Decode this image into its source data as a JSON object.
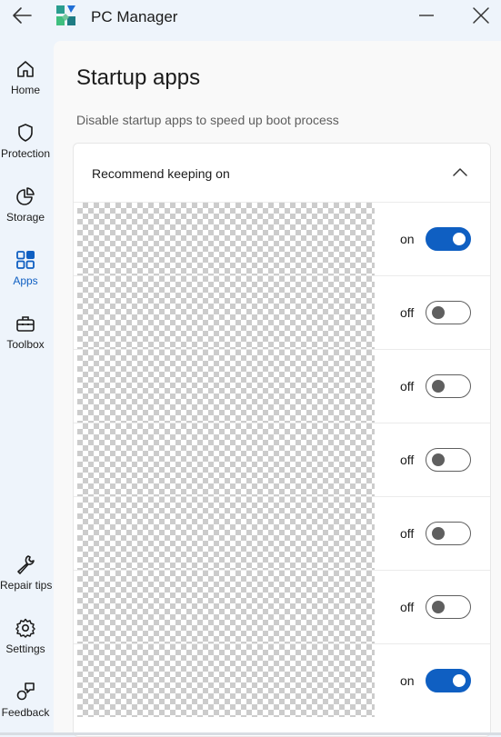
{
  "window": {
    "title": "PC Manager"
  },
  "sidebar": {
    "items": [
      {
        "label": "Home",
        "icon": "home-icon",
        "active": false
      },
      {
        "label": "Protection",
        "icon": "shield-icon",
        "active": false
      },
      {
        "label": "Storage",
        "icon": "pie-chart-icon",
        "active": false
      },
      {
        "label": "Apps",
        "icon": "apps-icon",
        "active": true
      },
      {
        "label": "Toolbox",
        "icon": "toolbox-icon",
        "active": false
      },
      {
        "label": "Repair tips",
        "icon": "wrench-icon",
        "active": false
      },
      {
        "label": "Settings",
        "icon": "gear-icon",
        "active": false
      },
      {
        "label": "Feedback",
        "icon": "feedback-icon",
        "active": false
      }
    ]
  },
  "main": {
    "title": "Startup apps",
    "subtitle": "Disable startup apps to speed up boot process",
    "section": {
      "label": "Recommend keeping on",
      "expanded": true,
      "apps": [
        {
          "state": "on"
        },
        {
          "state": "off"
        },
        {
          "state": "off"
        },
        {
          "state": "off"
        },
        {
          "state": "off"
        },
        {
          "state": "off"
        },
        {
          "state": "on"
        }
      ]
    }
  },
  "colors": {
    "accent": "#0f5fc2",
    "window_bg": "#eef4fb",
    "content_bg": "#f9f9f9"
  }
}
